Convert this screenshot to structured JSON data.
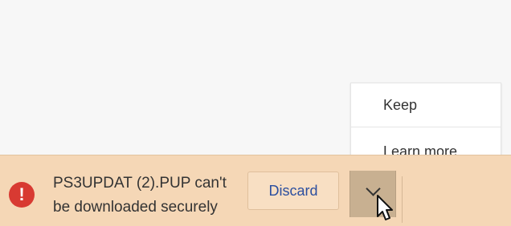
{
  "download_shelf": {
    "file_message": "PS3UPDAT (2).PUP can't be downloaded securely",
    "discard_button": "Discard",
    "warning_icon": "error-icon",
    "menu_icon": "chevron-down-icon"
  },
  "popup_menu": {
    "items": [
      {
        "label": "Keep"
      },
      {
        "label": "Learn more"
      }
    ]
  },
  "colors": {
    "shelf_background": "#f5d7b6",
    "warning_red": "#d83a32",
    "discard_text": "#2c4f9f",
    "menu_background": "#ffffff"
  }
}
